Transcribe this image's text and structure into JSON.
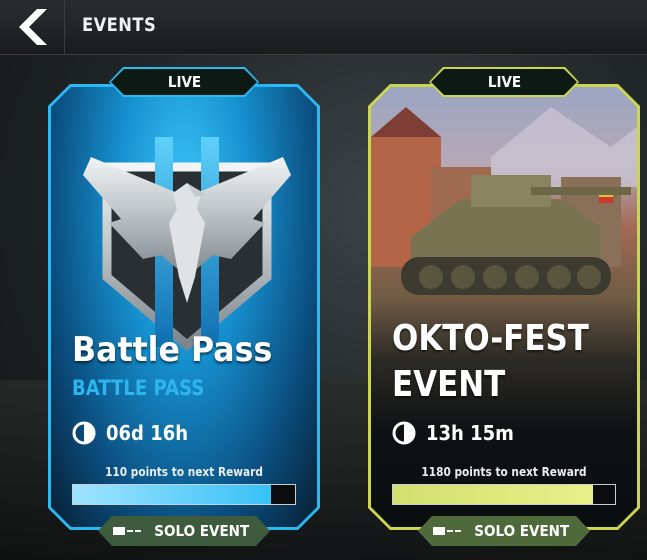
{
  "header": {
    "title": "EVENTS",
    "back_icon": "back-arrow-icon"
  },
  "events": [
    {
      "id": "battle-pass",
      "status": "LIVE",
      "title": "Battle Pass",
      "subtitle": "BATTLE PASS",
      "timer": "06d 16h",
      "points_text": "110 points to next Reward",
      "progress": 0.89,
      "type_label": "SOLO EVENT",
      "accent_color": "#2ab9f2"
    },
    {
      "id": "okto-fest",
      "status": "LIVE",
      "title_line1": "OKTO-FEST",
      "title_line2": "EVENT",
      "timer": "13h 15m",
      "points_text": "1180 points to next Reward",
      "progress": 0.9,
      "type_label": "SOLO EVENT",
      "accent_color": "#c9d64e"
    }
  ]
}
